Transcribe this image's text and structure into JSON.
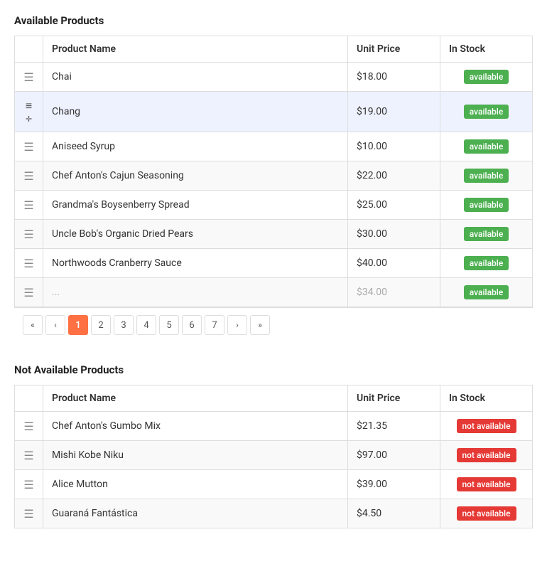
{
  "available_section": {
    "title": "Available Products",
    "columns": [
      "",
      "Product Name",
      "Unit Price",
      "In Stock"
    ],
    "rows": [
      {
        "id": 1,
        "name": "Chai",
        "price": "$18.00",
        "status": "available",
        "highlighted": false
      },
      {
        "id": 2,
        "name": "Chang",
        "price": "$19.00",
        "status": "available",
        "highlighted": true
      },
      {
        "id": 3,
        "name": "Aniseed Syrup",
        "price": "$10.00",
        "status": "available",
        "highlighted": false
      },
      {
        "id": 4,
        "name": "Chef Anton's Cajun Seasoning",
        "price": "$22.00",
        "status": "available",
        "highlighted": false
      },
      {
        "id": 5,
        "name": "Grandma's Boysenberry Spread",
        "price": "$25.00",
        "status": "available",
        "highlighted": false
      },
      {
        "id": 6,
        "name": "Uncle Bob's Organic Dried Pears",
        "price": "$30.00",
        "status": "available",
        "highlighted": false
      },
      {
        "id": 7,
        "name": "Northwoods Cranberry Sauce",
        "price": "$40.00",
        "status": "available",
        "highlighted": false
      }
    ],
    "pagination": {
      "current": 1,
      "pages": [
        "1",
        "2",
        "3",
        "4",
        "5",
        "6",
        "7"
      ],
      "first_label": "«",
      "prev_label": "‹",
      "next_label": "›",
      "last_label": "»"
    }
  },
  "not_available_section": {
    "title": "Not Available Products",
    "columns": [
      "",
      "Product Name",
      "Unit Price",
      "In Stock"
    ],
    "rows": [
      {
        "id": 1,
        "name": "Chef Anton's Gumbo Mix",
        "price": "$21.35",
        "status": "not available"
      },
      {
        "id": 2,
        "name": "Mishi Kobe Niku",
        "price": "$97.00",
        "status": "not available"
      },
      {
        "id": 3,
        "name": "Alice Mutton",
        "price": "$39.00",
        "status": "not available"
      },
      {
        "id": 4,
        "name": "Guaraná Fantástica",
        "price": "$4.50",
        "status": "not available"
      }
    ]
  },
  "badges": {
    "available": "available",
    "not_available": "not available"
  }
}
